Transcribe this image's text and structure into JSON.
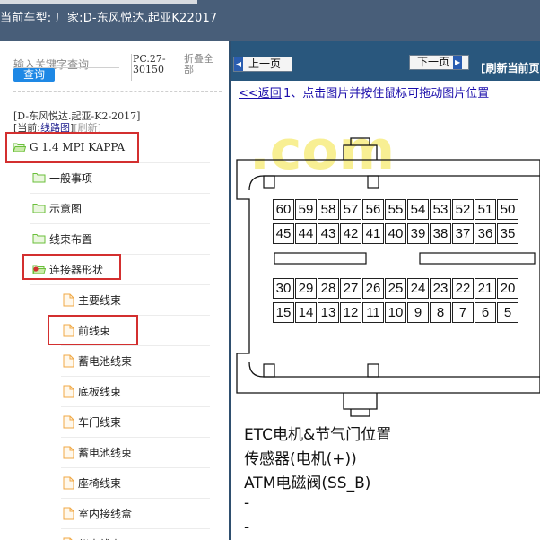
{
  "header": {
    "title": "当前车型:  厂家:D-东风悦达.起亚K22017"
  },
  "left_panel": {
    "search_label": "输入关键字查询",
    "query_button": "查询",
    "pc_code": "PC.27-30150",
    "collapse_all": "折叠全部",
    "model_line": "[D-东风悦达.起亚-K2-2017]",
    "current_prefix": "[当前:",
    "current_page": "线路图",
    "current_suffix": "]",
    "refresh_label": "[刷新]",
    "tree": [
      {
        "label": "G 1.4 MPI KAPPA",
        "icon": "folder-open-icon"
      },
      {
        "label": "一般事项",
        "icon": "folder-icon"
      },
      {
        "label": "示意图",
        "icon": "folder-icon"
      },
      {
        "label": "线束布置",
        "icon": "folder-icon"
      },
      {
        "label": "连接器形状",
        "icon": "folder-open-icon"
      },
      {
        "label": "主要线束",
        "icon": "document-icon"
      },
      {
        "label": "前线束",
        "icon": "document-icon"
      },
      {
        "label": "蓄电池线束",
        "icon": "document-icon"
      },
      {
        "label": "底板线束",
        "icon": "document-icon"
      },
      {
        "label": "车门线束",
        "icon": "document-icon"
      },
      {
        "label": "蓄电池线束",
        "icon": "document-icon"
      },
      {
        "label": "座椅线束",
        "icon": "document-icon"
      },
      {
        "label": "室内接线盒",
        "icon": "document-icon"
      },
      {
        "label": "仪表线束",
        "icon": "document-icon"
      }
    ]
  },
  "right_panel": {
    "prev_button": "上一页",
    "next_button": "下一页",
    "refresh_current": "[刷新当前页",
    "back_link": "<<返回",
    "hint": "1、点击图片并按住鼠标可拖动图片位置",
    "watermark": ".com",
    "connector_rows": [
      [
        "60",
        "59",
        "58",
        "57",
        "56",
        "55",
        "54",
        "53",
        "52",
        "51",
        "50"
      ],
      [
        "45",
        "44",
        "43",
        "42",
        "41",
        "40",
        "39",
        "38",
        "37",
        "36",
        "35"
      ],
      [
        "30",
        "29",
        "28",
        "27",
        "26",
        "25",
        "24",
        "23",
        "22",
        "21",
        "20"
      ],
      [
        "15",
        "14",
        "13",
        "12",
        "11",
        "10",
        "9",
        "8",
        "7",
        "6",
        "5"
      ]
    ],
    "pin_lines": [
      "ETC电机&节气门位置",
      "传感器(电机(+))",
      "ATM电磁阀(SS_B)",
      "-",
      "-"
    ]
  },
  "colors": {
    "header_bg": "#485e79",
    "nav_bg": "#29577d",
    "query_btn": "#1e88e5",
    "highlight_red": "#d32f2f",
    "folder_green": "#6abf3a",
    "document_orange": "#f0a845"
  }
}
